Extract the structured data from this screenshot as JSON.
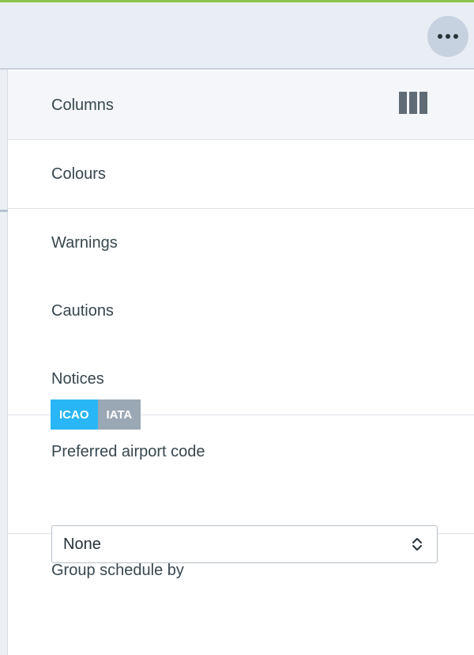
{
  "header": {
    "more_icon": "ellipsis-icon"
  },
  "menu": {
    "items": [
      {
        "label": "Columns",
        "icon": "columns-icon"
      },
      {
        "label": "Colours"
      },
      {
        "label": "Warnings"
      },
      {
        "label": "Cautions"
      },
      {
        "label": "Notices"
      }
    ]
  },
  "airport_code": {
    "label": "Preferred airport code",
    "options": [
      "ICAO",
      "IATA"
    ],
    "selected": "ICAO"
  },
  "group_schedule": {
    "label": "Group schedule by",
    "value": "None",
    "icon": "up-down-chevron-icon"
  },
  "colors": {
    "accent_top_border": "#8bc34a",
    "selected_segment": "#29b6f6",
    "unselected_segment": "#9aa7b4"
  }
}
